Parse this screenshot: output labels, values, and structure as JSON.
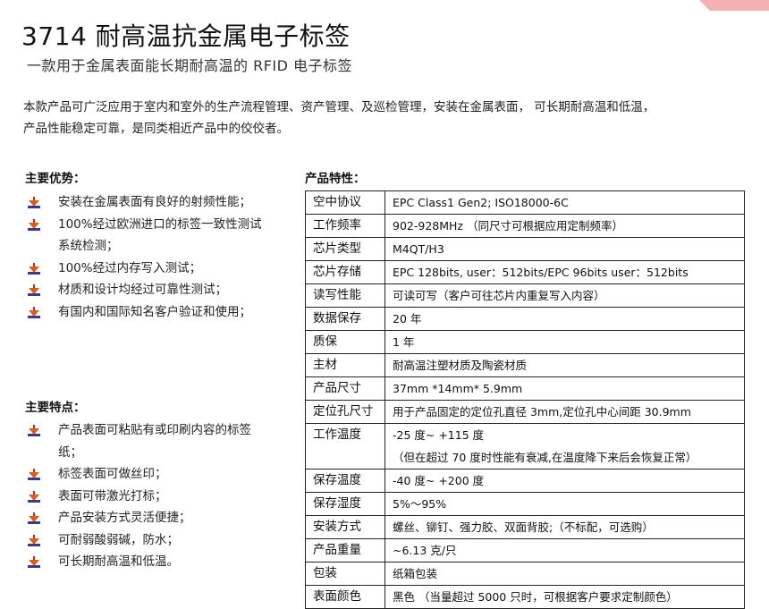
{
  "title": "3714 耐高温抗金属电子标签",
  "subtitle": "一款用于金属表面能长期耐高温的 RFID 电子标签",
  "intro": [
    "本款产品可广泛应用于室内和室外的生产流程管理、资产管理、及巡检管理，安装在金属表面， 可长期耐高温和低温，",
    "产品性能稳定可靠，是同类相近产品中的佼佼者。"
  ],
  "advantages": {
    "heading": "主要优势：",
    "items": [
      "安装在金属表面有良好的射频性能；",
      "100%经过欧洲进口的标签一致性测试系统检测；",
      "100%经过内存写入测试；",
      "材质和设计均经过可靠性测试；",
      "有国内和国际知名客户验证和使用；"
    ]
  },
  "features": {
    "heading": "主要特点：",
    "items": [
      "产品表面可粘贴有或印刷内容的标签纸；",
      "标签表面可做丝印；",
      "表面可带激光打标；",
      "产品安装方式灵活便捷；",
      "可耐弱酸弱碱，防水；",
      "可长期耐高温和低温。"
    ]
  },
  "specs": {
    "heading": "产品特性：",
    "rows": [
      {
        "key": "空中协议",
        "value": "EPC Class1 Gen2; ISO18000-6C"
      },
      {
        "key": "工作频率",
        "value": "902-928MHz （同尺寸可根据应用定制频率）"
      },
      {
        "key": "芯片类型",
        "value": "M4QT/H3"
      },
      {
        "key": "芯片存储",
        "value": "EPC 128bits, user：512bits/EPC 96bits user：512bits"
      },
      {
        "key": "读写性能",
        "value": "可读可写（客户可往芯片内重复写入内容）"
      },
      {
        "key": "数据保存",
        "value": "20 年"
      },
      {
        "key": "质保",
        "value": "1 年"
      },
      {
        "key": "主材",
        "value": "耐高温注塑材质及陶瓷材质"
      },
      {
        "key": "产品尺寸",
        "value": "37mm *14mm* 5.9mm"
      },
      {
        "key": "定位孔尺寸",
        "value": "用于产品固定的定位孔直径 3mm,定位孔中心间距 30.9mm"
      },
      {
        "key": "工作温度",
        "value": "-25 度~ +115 度",
        "note": "（但在超过 70 度时性能有衰减,在温度降下来后会恢复正常）"
      },
      {
        "key": "保存温度",
        "value": "-40 度~ +200 度"
      },
      {
        "key": "保存湿度",
        "value": "5%～95%"
      },
      {
        "key": "安装方式",
        "value": "螺丝、铆钉、强力胶、双面背胶;（不标配，可选购）"
      },
      {
        "key": "产品重量",
        "value": "~6.13 克/只"
      },
      {
        "key": "包装",
        "value": "纸箱包装"
      },
      {
        "key": "表面颜色",
        "value": "黑色 （当量超过 5000 只时，可根据客户要求定制颜色）"
      }
    ]
  }
}
